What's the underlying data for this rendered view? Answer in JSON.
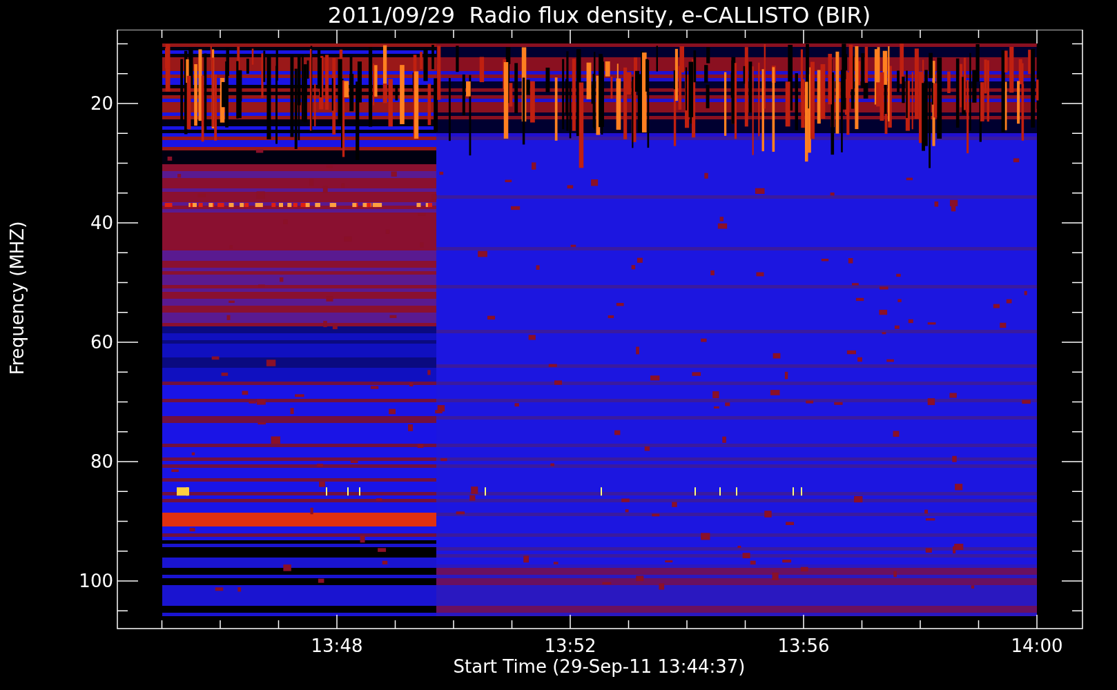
{
  "title": "2011/09/29  Radio flux density, e-CALLISTO (BIR)",
  "y_axis": {
    "label": "Frequency (MHZ)",
    "ticks": [
      "20",
      "40",
      "60",
      "80",
      "100"
    ]
  },
  "x_axis": {
    "label": "Start Time (29-Sep-11 13:44:37)",
    "ticks": [
      "13:48",
      "13:52",
      "13:56",
      "14:00"
    ]
  }
}
